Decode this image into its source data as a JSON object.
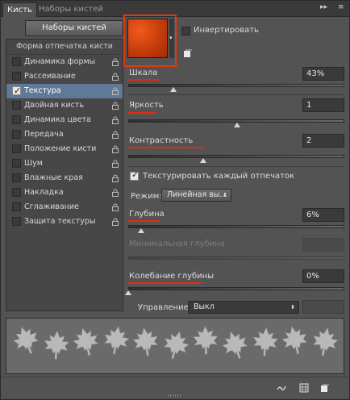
{
  "tabs": {
    "active": "Кисть",
    "inactive": "Наборы кистей",
    "controls": "▸▸ ≡"
  },
  "presets_button": "Наборы кистей",
  "list": {
    "header": "Форма отпечатка кисти",
    "items": [
      {
        "label": "Динамика формы",
        "checked": false,
        "lock": true
      },
      {
        "label": "Рассеивание",
        "checked": false,
        "lock": true
      },
      {
        "label": "Текстура",
        "checked": true,
        "lock": true,
        "selected": true
      },
      {
        "label": "Двойная кисть",
        "checked": false,
        "lock": true
      },
      {
        "label": "Динамика цвета",
        "checked": false,
        "lock": true
      },
      {
        "label": "Передача",
        "checked": false,
        "lock": true
      },
      {
        "label": "Положение кисти",
        "checked": false,
        "lock": true
      },
      {
        "label": "Шум",
        "checked": false,
        "lock": true
      },
      {
        "label": "Влажные края",
        "checked": false,
        "lock": true
      },
      {
        "label": "Накладка",
        "checked": false,
        "lock": true
      },
      {
        "label": "Сглаживание",
        "checked": false,
        "lock": true
      },
      {
        "label": "Защита текстуры",
        "checked": false,
        "lock": true
      }
    ]
  },
  "texture": {
    "swatch_color": "#d9440f",
    "invert_label": "Инвертировать",
    "invert_checked": false
  },
  "scale": {
    "label": "Шкала",
    "value": "43%",
    "slider": 0.3
  },
  "brightness": {
    "label": "Яркость",
    "value": "1",
    "slider": 0.51
  },
  "contrast": {
    "label": "Контрастность",
    "value": "2",
    "slider": 0.36
  },
  "texture_each": {
    "label": "Текстурировать каждый отпечаток",
    "checked": true
  },
  "mode": {
    "label": "Режим:",
    "value": "Линейная вы..."
  },
  "depth": {
    "label": "Глубина",
    "value": "6%",
    "slider": 0.06
  },
  "min_depth": {
    "label": "Минимальная глубина",
    "value": ""
  },
  "depth_jitter": {
    "label": "Колебание глубины",
    "value": "0%",
    "slider": 0.0
  },
  "control": {
    "label": "Управление:",
    "value": "Выкл"
  },
  "colors": {
    "accent_underline": "#e22a10",
    "panel_bg": "#535353",
    "selection": "#5f7a99"
  },
  "preview": {
    "leaf_count": 11
  }
}
